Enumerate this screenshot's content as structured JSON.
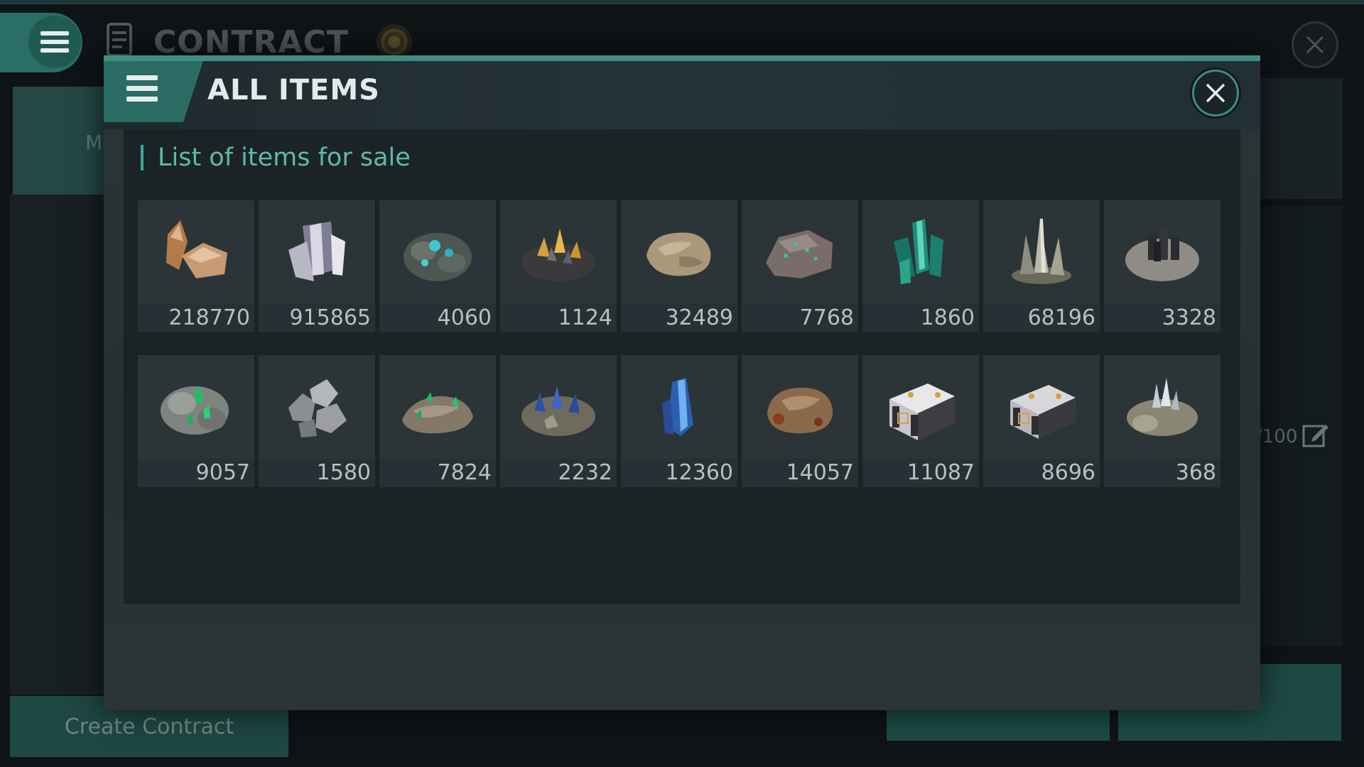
{
  "background": {
    "screen_title": "CONTRACT",
    "left_tab_letter": "M",
    "right_text": "/100",
    "create_button": "Create Contract"
  },
  "modal": {
    "title": "ALL ITEMS",
    "section_title": "List of items for sale",
    "items": [
      {
        "icon": "copper-ore-icon",
        "quantity": "218770"
      },
      {
        "icon": "silver-crystal-icon",
        "quantity": "915865"
      },
      {
        "icon": "cyan-mineral-rock-icon",
        "quantity": "4060"
      },
      {
        "icon": "gold-crystal-rock-icon",
        "quantity": "1124"
      },
      {
        "icon": "tan-stone-icon",
        "quantity": "32489"
      },
      {
        "icon": "speckled-rock-icon",
        "quantity": "7768"
      },
      {
        "icon": "green-crystal-icon",
        "quantity": "1860"
      },
      {
        "icon": "silver-shard-cluster-icon",
        "quantity": "68196"
      },
      {
        "icon": "dark-crystal-rock-icon",
        "quantity": "3328"
      },
      {
        "icon": "emerald-rock-icon",
        "quantity": "9057"
      },
      {
        "icon": "metal-ore-chunks-icon",
        "quantity": "1580"
      },
      {
        "icon": "green-vein-rock-icon",
        "quantity": "7824"
      },
      {
        "icon": "blue-crystal-rock-icon",
        "quantity": "2232"
      },
      {
        "icon": "blue-crystal-icon",
        "quantity": "12360"
      },
      {
        "icon": "brown-ore-icon",
        "quantity": "14057"
      },
      {
        "icon": "alloy-block-icon",
        "quantity": "11087"
      },
      {
        "icon": "alloy-block-icon",
        "quantity": "8696"
      },
      {
        "icon": "silver-crystal-rock-icon",
        "quantity": "368"
      }
    ]
  },
  "colors": {
    "accent_teal": "#3e8f83",
    "section_title": "#5fb9aa",
    "panel": "#1c2326"
  }
}
